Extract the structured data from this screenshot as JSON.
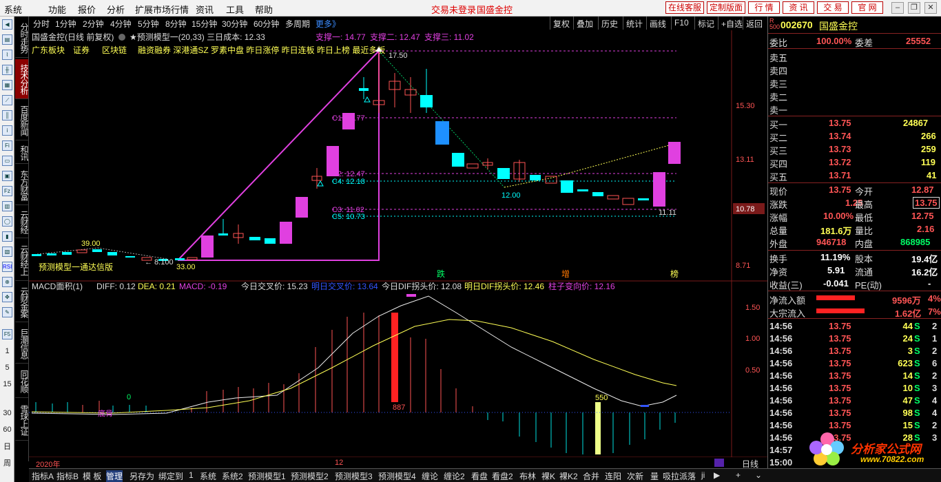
{
  "menu": {
    "items": [
      "系统",
      "功能",
      "报价",
      "分析",
      "扩展市场行情",
      "资讯",
      "工具",
      "帮助"
    ],
    "status": "交易未登录",
    "stock_title": "国盛金控",
    "right_buttons": [
      "在线客服",
      "定制版面",
      "行 情",
      "资 讯",
      "交 易",
      "官 网"
    ]
  },
  "left_toolbar": {
    "numbers": [
      "1",
      "5",
      "15",
      "30",
      "60",
      "日",
      "周"
    ]
  },
  "vertical_tabs": [
    "分时走势",
    "技术分析",
    "百度新闻",
    "和讯",
    "东方财富",
    "云财经",
    "云财经上",
    "云财金案",
    "巨潮信息",
    "同花顺",
    "雪球上证"
  ],
  "period_bar": {
    "periods": [
      "分时",
      "1分钟",
      "2分钟",
      "4分钟",
      "5分钟",
      "8分钟",
      "15分钟",
      "30分钟",
      "60分钟",
      "多周期"
    ],
    "more": "更多》",
    "tools": [
      "复权",
      "叠加",
      "历史",
      "统计",
      "画线",
      "F10",
      "标记",
      "+自选",
      "返回"
    ]
  },
  "chart": {
    "header_name": "国盛金控(日线 前复权)",
    "model_name": "★预测模型一(20,33) 三日成本: 12.33",
    "support": [
      "支撑一: 14.77",
      "支撑二: 12.47",
      "支撑三: 11.02"
    ],
    "concepts": [
      "广东板块",
      "证券",
      "区块链",
      "融资融券 深港通SZ 罗素中盘 昨日涨停 昨日连板 昨日上榜 最近多板"
    ],
    "ticks": [
      "15.30",
      "13.11",
      "10.78",
      "8.71"
    ],
    "current_price_tag": "10.78",
    "levels": [
      "C1: 14.77",
      "C2: 12.47",
      "C4: 12.18",
      "C3: 11.02",
      "C5: 10.73"
    ],
    "annotations": {
      "high": "17.50",
      "low": "12.00",
      "low2": "11.11",
      "a39": "39.00",
      "a33": "33.00",
      "a8": "← 8.100",
      "signal": "预测模型一通达信版",
      "die": "跌",
      "zeng": "增",
      "bang": "榜"
    },
    "macd_header": {
      "name": "MACD面积(1)",
      "diff": "DIFF: 0.12",
      "dea": "DEA: 0.21",
      "macd": "MACD: -0.19",
      "t1": "今日交叉价: 15.23",
      "t2": "明日交叉价: 13.64",
      "t3": "今日DIF拐头价: 12.08",
      "t4": "明日DIF拐头价: 12.46",
      "t5": "柱子变向价: 12.16"
    },
    "macd_ticks": [
      "1.50",
      "1.00",
      "0.50"
    ],
    "macd_labels": {
      "zero": "0",
      "bottom": "底背",
      "l887": "887",
      "l550": "550"
    },
    "date_labels": [
      "2020年",
      "12"
    ],
    "day_label": "日线"
  },
  "bottom_tabs": [
    "指标A",
    "指标B",
    "模 板",
    "管理",
    "另存为",
    "绑定到",
    "1",
    "系统",
    "系统2",
    "预测模型1",
    "预测模型2",
    "预测模型3",
    "预测模型4",
    "缠论",
    "缠论2",
    "看盘",
    "看盘2",
    "布林",
    "裸K",
    "裸K2",
    "合并",
    "连阳",
    "次新",
    "量",
    "吸拉派落",
    "ji"
  ],
  "quote": {
    "code": "002670",
    "name": "国盛金控",
    "wb": {
      "label": "委比",
      "value": "100.00%",
      "label2": "委差",
      "value2": "25552"
    },
    "sells": [
      "卖五",
      "卖四",
      "卖三",
      "卖二",
      "卖一"
    ],
    "buys": [
      {
        "label": "买一",
        "price": "13.75",
        "vol": "24867"
      },
      {
        "label": "买二",
        "price": "13.74",
        "vol": "266"
      },
      {
        "label": "买三",
        "price": "13.73",
        "vol": "259"
      },
      {
        "label": "买四",
        "price": "13.72",
        "vol": "119"
      },
      {
        "label": "买五",
        "price": "13.71",
        "vol": "41"
      }
    ],
    "stats": [
      {
        "l1": "现价",
        "v1": "13.75",
        "l2": "今开",
        "v2": "12.87"
      },
      {
        "l1": "涨跌",
        "v1": "1.25",
        "l2": "最高",
        "v2": "13.75"
      },
      {
        "l1": "涨幅",
        "v1": "10.00%",
        "l2": "最低",
        "v2": "12.75"
      },
      {
        "l1": "总量",
        "v1": "181.6万",
        "l2": "量比",
        "v2": "2.16"
      },
      {
        "l1": "外盘",
        "v1": "946718",
        "l2": "内盘",
        "v2": "868985"
      },
      {
        "l1": "换手",
        "v1": "11.19%",
        "l2": "股本",
        "v2": "19.4亿"
      },
      {
        "l1": "净资",
        "v1": "5.91",
        "l2": "流通",
        "v2": "16.2亿"
      },
      {
        "l1": "收益(三)",
        "v1": "-0.041",
        "l2": "PE(动)",
        "v2": "-"
      }
    ],
    "flow": [
      {
        "label": "净流入额",
        "value": "9596万",
        "pct": "4%"
      },
      {
        "label": "大宗流入",
        "value": "1.62亿",
        "pct": "7%"
      }
    ],
    "ticks": [
      {
        "t": "14:56",
        "p": "13.75",
        "v": "44",
        "d": "S",
        "n": "2"
      },
      {
        "t": "14:56",
        "p": "13.75",
        "v": "24",
        "d": "S",
        "n": "1"
      },
      {
        "t": "14:56",
        "p": "13.75",
        "v": "3",
        "d": "S",
        "n": "2"
      },
      {
        "t": "14:56",
        "p": "13.75",
        "v": "623",
        "d": "S",
        "n": "6"
      },
      {
        "t": "14:56",
        "p": "13.75",
        "v": "14",
        "d": "S",
        "n": "2"
      },
      {
        "t": "14:56",
        "p": "13.75",
        "v": "10",
        "d": "S",
        "n": "3"
      },
      {
        "t": "14:56",
        "p": "13.75",
        "v": "47",
        "d": "S",
        "n": "4"
      },
      {
        "t": "14:56",
        "p": "13.75",
        "v": "98",
        "d": "S",
        "n": "4"
      },
      {
        "t": "14:56",
        "p": "13.75",
        "v": "15",
        "d": "S",
        "n": "2"
      },
      {
        "t": "14:56",
        "p": "13.75",
        "v": "28",
        "d": "S",
        "n": "3"
      },
      {
        "t": "14:57",
        "p": "",
        "v": "",
        "d": "",
        "n": ""
      },
      {
        "t": "15:00",
        "p": "",
        "v": "",
        "d": "",
        "n": ""
      }
    ],
    "watermark": {
      "text": "分析家公式网",
      "url": "www.70822.com"
    }
  },
  "colors": {
    "up": "#ff3333",
    "down": "#00e0e0",
    "magenta": "#e040e0",
    "yellow": "#ffff55",
    "cyan": "#00ffff",
    "grey": "#888888"
  }
}
